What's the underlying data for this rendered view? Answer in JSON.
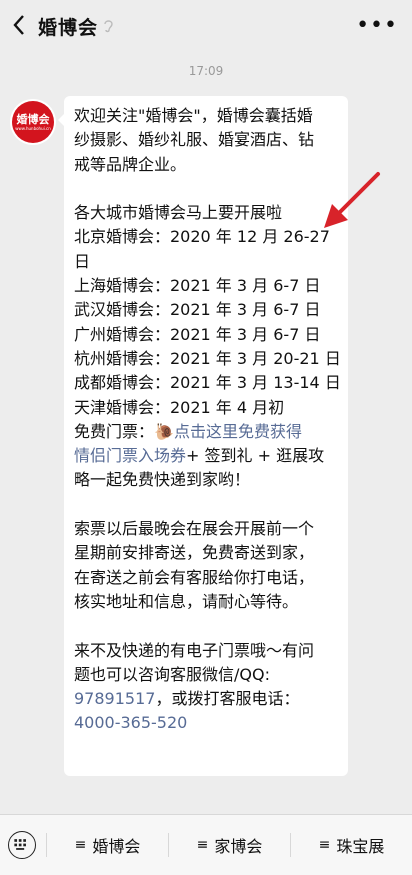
{
  "header": {
    "title": "婚博会",
    "back_icon": "chevron-left-icon",
    "more_icon": "more-dots-icon"
  },
  "timestamp": "17:09",
  "avatar": {
    "text": "婚博会",
    "subtext": "www.hunbohui.cn"
  },
  "message": {
    "lines": [
      "欢迎关注\"婚博会\"，婚博会囊括婚",
      "纱摄影、婚纱礼服、婚宴酒店、钻",
      "戒等品牌企业。",
      "",
      "各大城市婚博会马上要开展啦",
      "北京婚博会：2020 年 12 月 26-27",
      "日",
      "上海婚博会：2021 年 3 月 6-7 日",
      "武汉婚博会：2021 年 3 月 6-7 日",
      "广州婚博会：2021 年 3 月 6-7 日",
      "杭州婚博会：2021 年 3 月 20-21 日",
      "成都婚博会：2021 年 3 月 13-14 日",
      "天津婚博会：2021 年 4 月初"
    ],
    "ticket_prefix": "免费门票：",
    "ticket_emoji": "🐌",
    "ticket_link_1": "点击这里免费获得",
    "ticket_link_2": "情侣门票入场券",
    "ticket_suffix_2": "+ 签到礼 + 逛展攻",
    "ticket_line_3": "略一起免费快递到家哟！",
    "para2": [
      "索票以后最晚会在展会开展前一个",
      "星期前安排寄送，免费寄送到家，",
      "在寄送之前会有客服给你打电话，",
      "核实地址和信息，请耐心等待。"
    ],
    "para3_l1": "来不及快递的有电子门票哦～有问",
    "para3_l2": "题也可以咨询客服微信/QQ:",
    "qq": "97891517",
    "para3_l3_suffix": "，或拨打客服电话：",
    "phone": "4000-365-520"
  },
  "bottom_menu": [
    {
      "label": "婚博会"
    },
    {
      "label": "家博会"
    },
    {
      "label": "珠宝展"
    }
  ],
  "colors": {
    "link": "#576b95",
    "arrow": "#d8232a",
    "avatar_bg": "#d3141e"
  }
}
